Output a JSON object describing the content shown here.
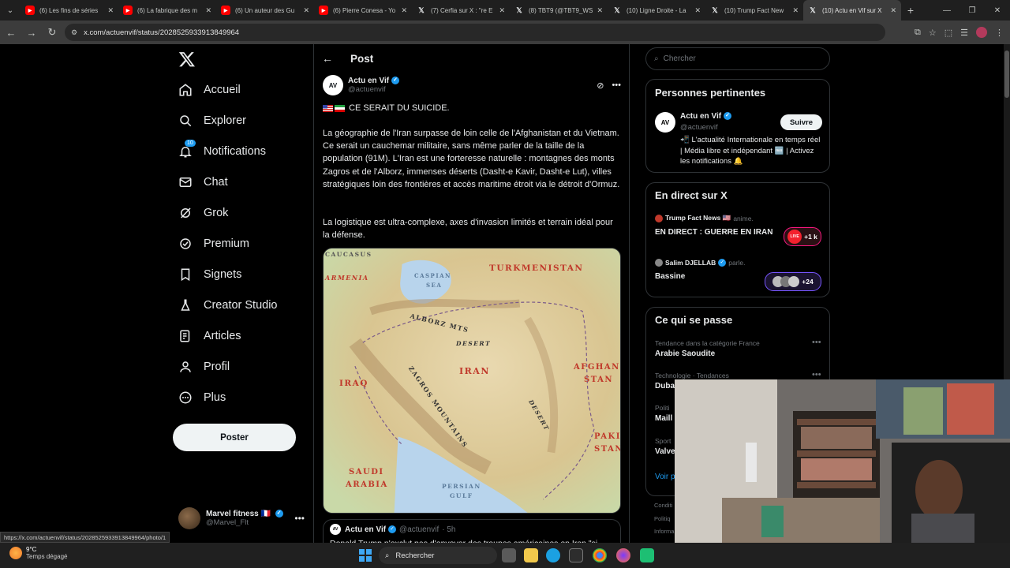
{
  "browser": {
    "tabs": [
      {
        "title": "(6) Les fins de séries",
        "icon": "youtube-icon"
      },
      {
        "title": "(6) La fabrique des m",
        "icon": "youtube-icon"
      },
      {
        "title": "(6) Un auteur des Gu",
        "icon": "youtube-icon"
      },
      {
        "title": "(6) Pierre Conesa - Yo",
        "icon": "youtube-icon"
      },
      {
        "title": "(7) Cerfia sur X : \"re E",
        "icon": "x-icon"
      },
      {
        "title": "(8) TBT9 (@TBT9_WS",
        "icon": "x-icon"
      },
      {
        "title": "(10) Ligne Droite - La",
        "icon": "x-icon"
      },
      {
        "title": "(10) Trump Fact New",
        "icon": "x-icon"
      },
      {
        "title": "(10) Actu en Vif sur X",
        "icon": "x-icon"
      }
    ],
    "url": "x.com/actuenvif/status/2028525933913849964",
    "status_url": "https://x.com/actuenvif/status/2028525933913849964/photo/1"
  },
  "nav": {
    "items": [
      {
        "label": "Accueil",
        "icon": "home-icon"
      },
      {
        "label": "Explorer",
        "icon": "search-icon"
      },
      {
        "label": "Notifications",
        "icon": "bell-icon",
        "badge": "10"
      },
      {
        "label": "Chat",
        "icon": "mail-icon"
      },
      {
        "label": "Grok",
        "icon": "grok-icon"
      },
      {
        "label": "Premium",
        "icon": "premium-icon"
      },
      {
        "label": "Signets",
        "icon": "bookmark-icon"
      },
      {
        "label": "Creator Studio",
        "icon": "flask-icon"
      },
      {
        "label": "Articles",
        "icon": "article-icon"
      },
      {
        "label": "Profil",
        "icon": "person-icon"
      },
      {
        "label": "Plus",
        "icon": "more-circle-icon"
      }
    ],
    "post_button": "Poster",
    "account": {
      "name": "Marvel fitness",
      "handle": "@Marvel_Flt"
    }
  },
  "post": {
    "header": "Post",
    "author_name": "Actu en Vif",
    "author_handle": "@actuenvif",
    "avatar_text": "AV",
    "headline": "CE SERAIT DU SUICIDE.",
    "paragraph1": "La géographie de l'Iran surpasse de loin celle de l'Afghanistan et du Vietnam. Ce serait un cauchemar militaire, sans même parler de la taille de la population (91M). L'Iran est une forteresse naturelle : montagnes des monts Zagros et de l'Alborz, immenses déserts (Dasht-e Kavir, Dasht-e Lut), villes stratégiques loin des frontières et accès maritime étroit via le détroit d'Ormuz.",
    "paragraph2": "La logistique est ultra-complexe, axes d'invasion limités et terrain idéal pour la défense.",
    "map_labels": {
      "caucasus": "CAUCASUS",
      "armenia": "ARMENIA",
      "caspian1": "CASPIAN",
      "caspian2": "SEA",
      "turkmenistan": "TURKMENISTAN",
      "alborz": "ALBORZ MTS",
      "desert1": "DESERT",
      "iran": "IRAN",
      "iraq": "IRAQ",
      "zagros": "ZAGROS MOUNTAINS",
      "afghani1": "AFGHANI-",
      "afghani2": "STAN",
      "desert2": "DESERT",
      "paki1": "PAKI-",
      "paki2": "STAN",
      "saudi1": "SAUDI",
      "saudi2": "ARABIA",
      "persian1": "PERSIAN",
      "persian2": "GULF"
    },
    "quote": {
      "name": "Actu en Vif",
      "handle": "@actuenvif",
      "time": "· 5h",
      "text": "Donald Trump n'exclut pas d'envoyer des troupes américaines en Iran \"si"
    }
  },
  "right": {
    "search_placeholder": "Chercher",
    "relevant": {
      "title": "Personnes pertinentes",
      "name": "Actu en Vif",
      "handle": "@actuenvif",
      "follow": "Suivre",
      "bio": "📲 L'actualité Internationale en temps réel | Média libre et indépendant 🆓 | Activez les notifications 🔔"
    },
    "live": {
      "title": "En direct sur X",
      "items": [
        {
          "host": "Trump Fact News 🇺🇸",
          "action": "anime.",
          "title": "EN DIRECT : GUERRE EN IRAN",
          "count": "+1 k"
        },
        {
          "host": "Salim DJELLAB",
          "action": "parle.",
          "title": "Bassine",
          "count": "+24"
        }
      ]
    },
    "trends": {
      "title": "Ce qui se passe",
      "items": [
        {
          "meta": "Tendance dans la catégorie France",
          "title": "Arabie Saoudite"
        },
        {
          "meta": "Technologie · Tendances",
          "title": "Duba"
        },
        {
          "meta": "Politi",
          "title": "Maill"
        },
        {
          "meta": "Sport",
          "title": "Valve"
        }
      ],
      "see_more": "Voir p"
    },
    "footer": [
      "Conditi",
      "Politiq",
      "Informa"
    ]
  },
  "taskbar": {
    "temp": "9°C",
    "weather": "Temps dégagé",
    "search": "Rechercher"
  },
  "colors": {
    "accent": "#1d9bf0",
    "background": "#000000",
    "border": "#2f3336"
  }
}
